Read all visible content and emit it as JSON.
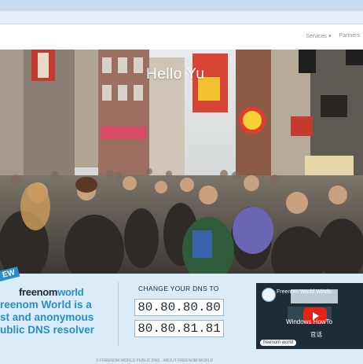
{
  "header": {
    "nav": [
      "Services ▾",
      "Partners"
    ]
  },
  "hero": {
    "title": "Hello Yu"
  },
  "brand": {
    "logo_free": "freenom",
    "logo_world": "world",
    "badge": "EW"
  },
  "tagline": {
    "lines": [
      "reenom World is a",
      "st and anonymous",
      "ublic DNS resolver"
    ]
  },
  "dns": {
    "title": "CHANGE YOUR DNS TO",
    "primary": "80.80.80.80",
    "secondary": "80.80.81.81"
  },
  "video": {
    "title": "Freenom World Windo...",
    "subtitle": "Windows HowTo",
    "subtitle2": "官话",
    "brand": "freenom world"
  },
  "footer": {
    "text": "© FREENOM WORLD PUBLIC DNS · ABOUT FREENOM WORLD"
  },
  "colors": {
    "accent": "#2a8fc8",
    "panel_bg": "#d9ecf7",
    "youtube_red": "#e62117"
  }
}
